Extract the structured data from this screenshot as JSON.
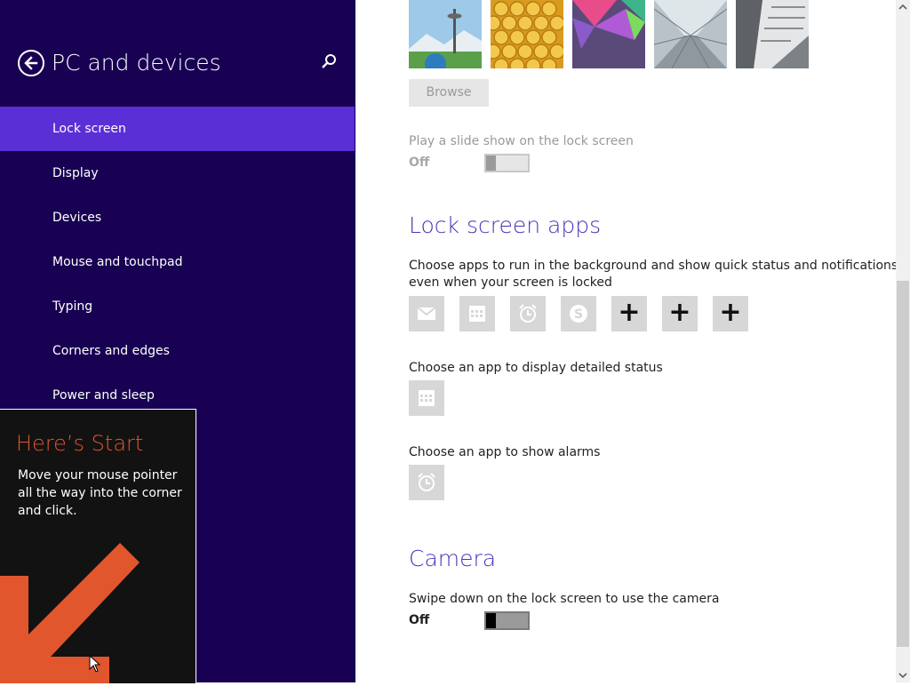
{
  "nav": {
    "title": "PC and devices",
    "items": [
      {
        "label": "Lock screen"
      },
      {
        "label": "Display"
      },
      {
        "label": "Devices"
      },
      {
        "label": "Mouse and touchpad"
      },
      {
        "label": "Typing"
      },
      {
        "label": "Corners and edges"
      },
      {
        "label": "Power and sleep"
      }
    ],
    "selected_index": 0
  },
  "tip": {
    "title": "Here’s Start",
    "body": "Move your mouse pointer all the way into the corner and click."
  },
  "content": {
    "background_thumbnails": [
      "space-needle",
      "honeycomb",
      "geometric",
      "train-tunnel",
      "piano-keys"
    ],
    "browse_label": "Browse",
    "slideshow": {
      "label": "Play a slide show on the lock screen",
      "state": "Off",
      "enabled": false
    },
    "lock_screen_apps": {
      "heading": "Lock screen apps",
      "description_line1": "Choose apps to run in the background and show quick status and notifications,",
      "description_line2": "even when your screen is locked",
      "apps": [
        "mail-icon",
        "calendar-icon",
        "alarm-icon",
        "skype-icon"
      ],
      "add_slots": [
        "+",
        "+",
        "+"
      ]
    },
    "detailed_status": {
      "label": "Choose an app to display detailed status",
      "app": "calendar-icon"
    },
    "alarms": {
      "label": "Choose an app to show alarms",
      "app": "alarm-icon"
    },
    "camera": {
      "heading": "Camera",
      "label": "Swipe down on the lock screen to use the camera",
      "state": "Off"
    }
  },
  "colors": {
    "nav_background": "#180052",
    "nav_selected": "#5b2fd6",
    "heading_accent": "#4f32b8",
    "tip_accent": "#e2562d"
  }
}
